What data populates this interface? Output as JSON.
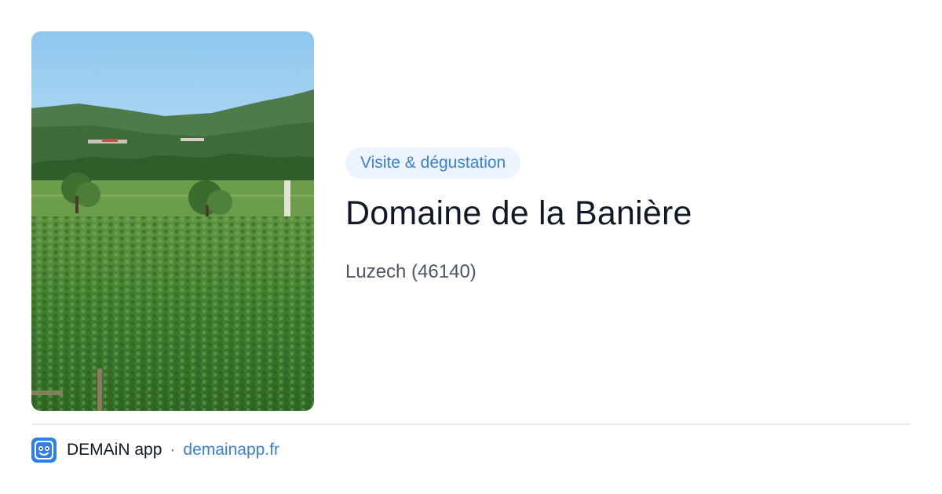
{
  "listing": {
    "category_badge": "Visite & dégustation",
    "title": "Domaine de la Banière",
    "location": "Luzech (46140)",
    "photo_icon": "vineyard-photo"
  },
  "footer": {
    "app_icon": "demain-app-logo-icon",
    "app_name": "DEMAiN app",
    "separator": "·",
    "site": "demainapp.fr"
  },
  "colors": {
    "accent": "#3b80d4",
    "badge_bg": "#edf4fd",
    "title": "#111827",
    "muted": "#4b5563",
    "divider": "#e3ebef",
    "logo_blue": "#2f7fe6"
  }
}
